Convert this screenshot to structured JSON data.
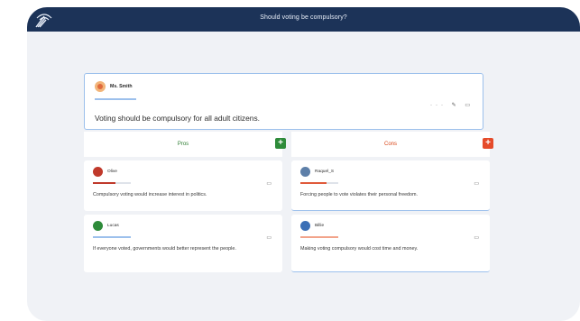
{
  "app": {
    "title": "Should voting be compulsory?"
  },
  "topic": {
    "author": "Ms. Smith",
    "statement": "Voting should be compulsory for all adult citizens.",
    "tools": "··· ✎ ▭"
  },
  "columns": {
    "pros": {
      "label": "Pros",
      "add_icon": "+"
    },
    "cons": {
      "label": "Cons",
      "add_icon": "+"
    }
  },
  "pros": [
    {
      "author": "Olive",
      "text": "Compulsory voting would increase interest in politics."
    },
    {
      "author": "Lucas",
      "text": "If everyone voted, governments would better represent the people."
    }
  ],
  "cons": [
    {
      "author": "Raquel_S",
      "text": "Forcing people to vote violates their personal freedom."
    },
    {
      "author": "Billie",
      "text": "Making voting compulsory would cost time and money."
    }
  ],
  "colors": {
    "topbar": "#1c3358",
    "pros_accent": "#2e8b3a",
    "cons_accent": "#e54b2a"
  }
}
